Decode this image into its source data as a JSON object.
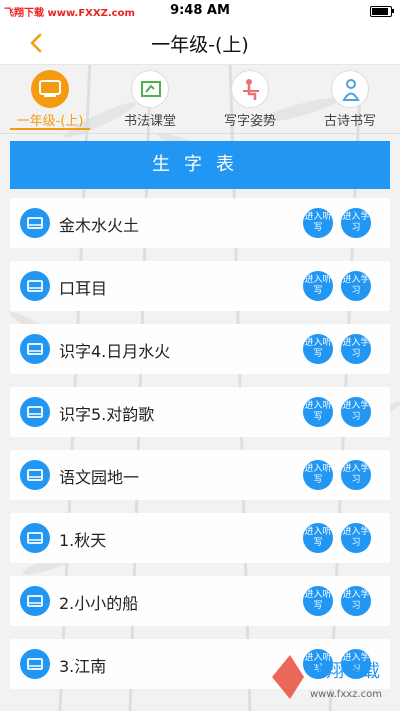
{
  "status_bar": {
    "carrier": "飞翔下载 www.FXXZ.com",
    "time": "9:48 AM"
  },
  "nav": {
    "title": "一年级-(上)",
    "back_icon": "chevron-left-icon"
  },
  "tabs": [
    {
      "label": "一年级-(上)",
      "icon": "monitor-icon",
      "active": true
    },
    {
      "label": "书法课堂",
      "icon": "board-icon",
      "active": false
    },
    {
      "label": "写字姿势",
      "icon": "writing-posture-icon",
      "active": false
    },
    {
      "label": "古诗书写",
      "icon": "poet-icon",
      "active": false
    }
  ],
  "section": {
    "title": "生字表"
  },
  "buttons": {
    "listen": "进入听写",
    "study": "进入学习"
  },
  "rows": [
    {
      "title": "金木水火土"
    },
    {
      "title": "口耳目"
    },
    {
      "title": "识字4.日月水火"
    },
    {
      "title": "识字5.对韵歌"
    },
    {
      "title": "语文园地一"
    },
    {
      "title": "1.秋天"
    },
    {
      "title": "2.小小的船"
    },
    {
      "title": "3.江南"
    }
  ],
  "watermark": {
    "brand": "飞翔下载",
    "url": "www.fxxz.com"
  },
  "colors": {
    "accent": "#f39c12",
    "primary": "#2196f3"
  }
}
